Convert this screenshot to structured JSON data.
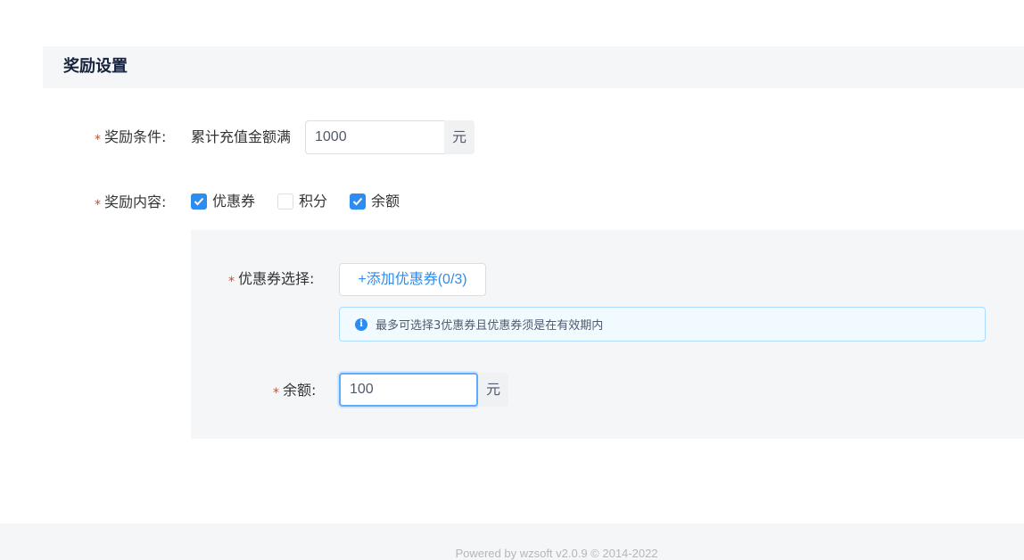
{
  "section": {
    "title": "奖励设置"
  },
  "reward_condition": {
    "required_mark": "*",
    "label": "奖励条件:",
    "prefix": "累计充值金额满",
    "value": "1000",
    "unit": "元"
  },
  "reward_content": {
    "required_mark": "*",
    "label": "奖励内容:",
    "options": [
      {
        "label": "优惠券",
        "checked": true
      },
      {
        "label": "积分",
        "checked": false
      },
      {
        "label": "余额",
        "checked": true
      }
    ]
  },
  "coupon": {
    "required_mark": "*",
    "label": "优惠券选择:",
    "add_button": "+添加优惠券(0/3)",
    "info_icon": "info-icon",
    "info_text": "最多可选择3优惠券且优惠券须是在有效期内"
  },
  "balance": {
    "required_mark": "*",
    "label": "余额:",
    "value": "100",
    "unit": "元"
  },
  "footer": {
    "text": "Powered by wzsoft v2.0.9 © 2014-2022"
  },
  "colors": {
    "primary": "#2d8cf0",
    "required": "#ed4014",
    "panel_bg": "#f5f6f8"
  }
}
